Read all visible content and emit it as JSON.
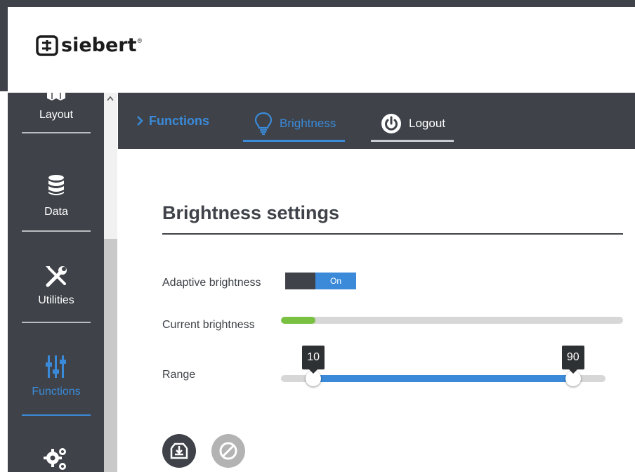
{
  "logo": {
    "text": "siebert",
    "reg": "®"
  },
  "sidebar": {
    "items": [
      {
        "label": "Layout",
        "icon": "layout-icon"
      },
      {
        "label": "Data",
        "icon": "database-icon"
      },
      {
        "label": "Utilities",
        "icon": "tools-icon"
      },
      {
        "label": "Functions",
        "icon": "sliders-icon",
        "active": true
      },
      {
        "label": "",
        "icon": "gears-icon"
      }
    ]
  },
  "topnav": {
    "crumb": "Functions",
    "tabs": [
      {
        "label": "Brightness",
        "icon": "lightbulb-icon",
        "active": true
      },
      {
        "label": "Logout",
        "icon": "power-icon"
      }
    ]
  },
  "settings": {
    "title": "Brightness settings",
    "adaptive": {
      "label": "Adaptive brightness",
      "state": "On"
    },
    "current": {
      "label": "Current brightness",
      "level_fraction": 0.1
    },
    "range": {
      "label": "Range",
      "min": 10,
      "max": 90,
      "scale_min": 0,
      "scale_max": 100
    }
  },
  "colors": {
    "accent": "#3a8ad9",
    "dark": "#3f4349",
    "meter": "#7ac142"
  }
}
